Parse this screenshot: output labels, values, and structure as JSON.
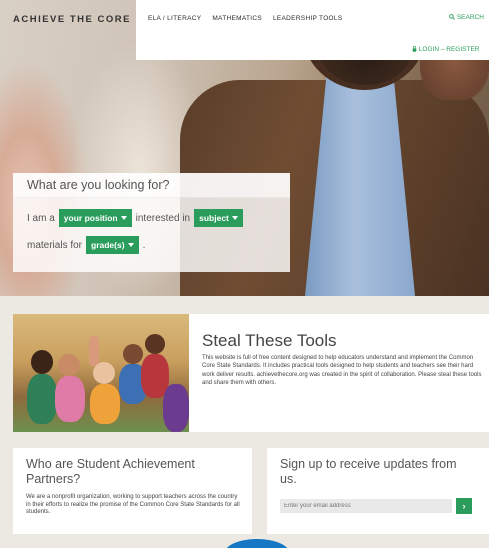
{
  "header": {
    "brand": "ACHIEVE THE CORE",
    "nav": [
      "ELA / LITERACY",
      "MATHEMATICS",
      "LEADERSHIP TOOLS"
    ],
    "search_label": "SEARCH",
    "login_label": "LOGIN – REGISTER"
  },
  "finder": {
    "question": "What are you looking for?",
    "i_am": "I am a",
    "position": "your position",
    "interested_in": "interested in",
    "subject": "subject",
    "materials_for": "materials for",
    "grades": "grade(s)",
    "period": "."
  },
  "steal": {
    "title": "Steal These Tools",
    "body": "This website is full of free content designed to help educators understand and implement the Common Core State Standards. It includes practical tools designed to help students and teachers see their hard work deliver results. achievethecore.org was created in the spirit of collaboration. Please steal these tools and share them with others."
  },
  "who": {
    "title": "Who are Student Achievement Partners?",
    "body": "We are a nonprofit organization, working to support teachers across the country in their efforts to realize the promise of the Common Core State Standards for all students."
  },
  "signup": {
    "title": "Sign up to receive updates from us.",
    "email_placeholder": "Enter your email address",
    "submit": "›"
  },
  "colors": {
    "accent": "#2a9d5c",
    "blue": "#1677c4"
  }
}
